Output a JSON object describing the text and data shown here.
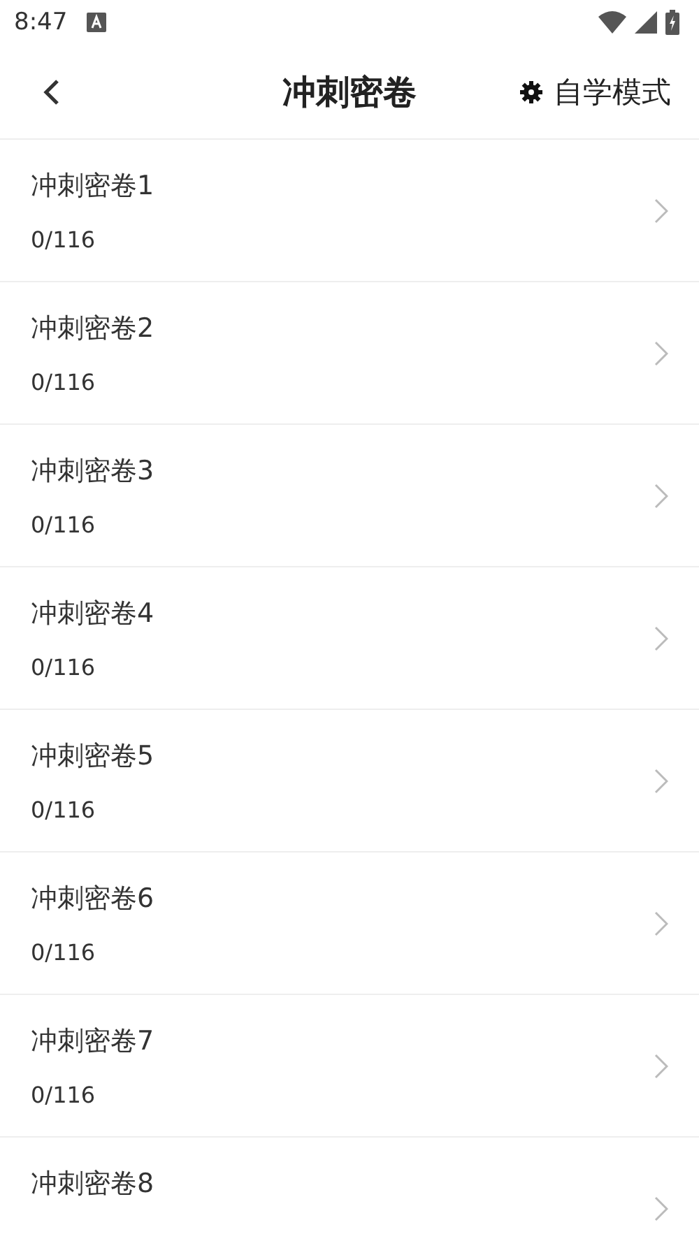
{
  "status_bar": {
    "time": "8:47"
  },
  "header": {
    "title": "冲刺密卷",
    "action": "自学模式"
  },
  "items": [
    {
      "title": "冲刺密卷1",
      "progress": "0/116"
    },
    {
      "title": "冲刺密卷2",
      "progress": "0/116"
    },
    {
      "title": "冲刺密卷3",
      "progress": "0/116"
    },
    {
      "title": "冲刺密卷4",
      "progress": "0/116"
    },
    {
      "title": "冲刺密卷5",
      "progress": "0/116"
    },
    {
      "title": "冲刺密卷6",
      "progress": "0/116"
    },
    {
      "title": "冲刺密卷7",
      "progress": "0/116"
    },
    {
      "title": "冲刺密卷8"
    }
  ]
}
